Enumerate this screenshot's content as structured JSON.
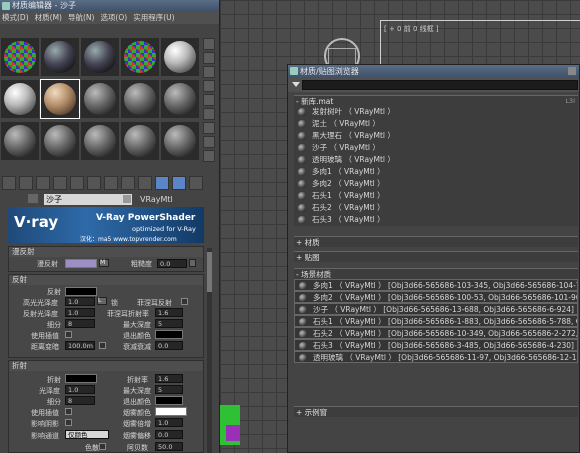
{
  "viewport": {
    "label": "[ + 0 前 0 线框 ]"
  },
  "material_editor": {
    "title": "材质编辑器 - 沙子",
    "menu": [
      "模式(D)",
      "材质(M)",
      "导航(N)",
      "选项(O)",
      "实用程序(U)"
    ],
    "material_name": "沙子",
    "material_type": "VRayMtl",
    "banner": {
      "logo": "V·ray",
      "line1": "V-Ray PowerShader",
      "line2": "optimized for V-Ray",
      "line3": "汉化：ma5 www.topvrender.com"
    },
    "diffuse": {
      "header": "漫反射",
      "diffuse_label": "漫反射",
      "roughness_label": "粗糙度",
      "roughness_value": "0.0",
      "map_button": "M"
    },
    "reflection": {
      "header": "反射",
      "reflect_label": "反射",
      "hilight_gloss_label": "高光光泽度",
      "hilight_gloss_value": "1.0",
      "lock_label": "L",
      "lock_text": "锁",
      "fresnel_label": "菲涅耳反射",
      "refl_gloss_label": "反射光泽度",
      "refl_gloss_value": "1.0",
      "fresnel_ior_label": "菲涅耳折射率",
      "fresnel_ior_value": "1.6",
      "subdivs_label": "细分",
      "subdivs_value": "8",
      "max_depth_label": "最大深度",
      "max_depth_value": "5",
      "use_interp_label": "使用插值",
      "exit_color_label": "退出颜色",
      "dist_dim_label": "距离变暗",
      "dist_dim_value": "100.0m",
      "dim_falloff_label": "衰减衰减",
      "dim_falloff_value": "0.0"
    },
    "refraction": {
      "header": "折射",
      "refract_label": "折射",
      "ior_label": "折射率",
      "ior_value": "1.6",
      "gloss_label": "光泽度",
      "gloss_value": "1.0",
      "max_depth_label": "最大深度",
      "max_depth_value": "5",
      "subdivs_label": "细分",
      "subdivs_value": "8",
      "exit_color_label": "退出颜色",
      "use_interp_label": "使用插值",
      "fog_color_label": "烟雾颜色",
      "affect_shadows_label": "影响阴影",
      "fog_mult_label": "烟雾倍增",
      "fog_mult_value": "1.0",
      "affect_channels_label": "影响通道",
      "affect_channels_value": "仅颜色",
      "fog_bias_label": "烟雾偏移",
      "fog_bias_value": "0.0",
      "dispersion_label": "色散",
      "abbe_label": "阿贝数",
      "abbe_value": "50.0"
    },
    "slots": [
      "checker",
      "dark",
      "dark",
      "checker",
      "white",
      "white",
      "sand",
      "grey",
      "grey",
      "grey",
      "grey",
      "grey",
      "grey",
      "grey",
      "grey"
    ]
  },
  "browser": {
    "title": "材质/贴图浏览器",
    "groups": {
      "new_lib": {
        "header": "- 新库.mat",
        "right": "L3I"
      },
      "materials_header": "+ 材质",
      "maps_header": "+ 贴图",
      "scene_header": "- 场景材质",
      "samples_header": "+ 示例窗"
    },
    "library_items": [
      "发射树叶 （ VRayMtl ）",
      "泥土 （ VRayMtl ）",
      "黑大理石 （ VRayMtl ）",
      "沙子 （ VRayMtl ）",
      "透明玻璃 （ VRayMtl ）",
      "多肉1 （ VRayMtl ）",
      "多肉2 （ VRayMtl ）",
      "石头1 （ VRayMtl ）",
      "石头2 （ VRayMtl ）",
      "石头3 （ VRayMtl ）"
    ],
    "scene_items": [
      "多肉1 （ VRayMtl ） [Obj3d66-565686-103-345, Obj3d66-565686-104-746, Obj3d6",
      "多肉2 （ VRayMtl ） [Obj3d66-565686-100-53, Obj3d66-565686-101-962, Obj3d6",
      "沙子 （ VRayMtl ） [Obj3d66-565686-13-688, Obj3d66-565686-6-924]",
      "石头1 （ VRayMtl ） [Obj3d66-565686-1-883, Obj3d66-565686-5-788, Obj3d66",
      "石头2 （ VRayMtl ） [Obj3d66-565686-10-349, Obj3d66-565686-2-272, Obj3d66",
      "石头3 （ VRayMtl ） [Obj3d66-565686-3-485, Obj3d66-565686-4-230]",
      "透明玻璃 （ VRayMtl ） [Obj3d66-565686-11-97, Obj3d66-565686-12-134]"
    ]
  }
}
